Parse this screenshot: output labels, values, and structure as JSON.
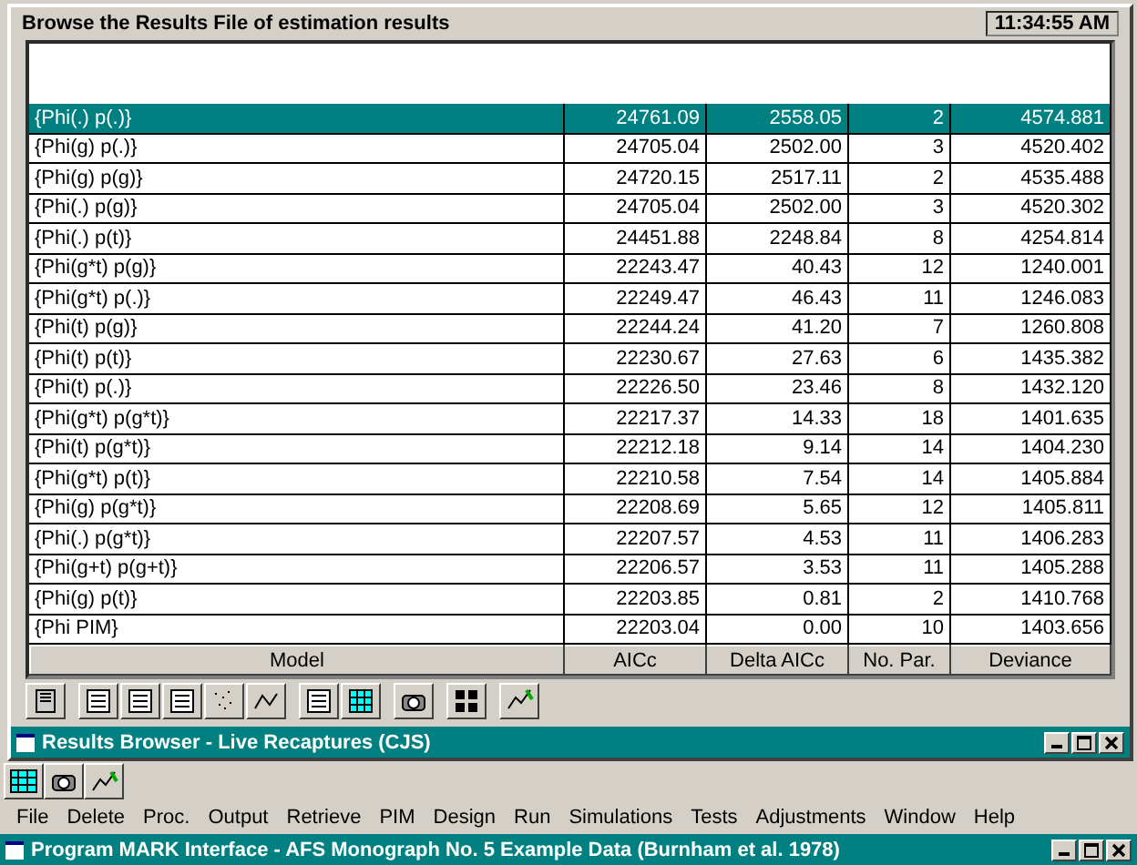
{
  "window": {
    "title": "Program MARK Interface - AFS Monograph No. 5 Example Data (Burnham et al. 1978)"
  },
  "menu": [
    "File",
    "Delete",
    "Proc.",
    "Output",
    "Retrieve",
    "PIM",
    "Design",
    "Run",
    "Simulations",
    "Tests",
    "Adjustments",
    "Window",
    "Help"
  ],
  "browser": {
    "title": "Results Browser - Live Recaptures (CJS)",
    "rows": [
      {
        "selected": true,
        "cells": [
          "{Phi(.) p(.)}",
          "24761.09",
          "2558.05",
          "2",
          "4574.881"
        ]
      },
      {
        "selected": false,
        "cells": [
          "{Phi(g) p(.)}",
          "24705.04",
          "2502.00",
          "3",
          "4520.402"
        ]
      },
      {
        "selected": false,
        "cells": [
          "{Phi(g) p(g)}",
          "24720.15",
          "2517.11",
          "2",
          "4535.488"
        ]
      },
      {
        "selected": false,
        "cells": [
          "{Phi(.) p(g)}",
          "24705.04",
          "2502.00",
          "3",
          "4520.302"
        ]
      },
      {
        "selected": false,
        "cells": [
          "{Phi(.) p(t)}",
          "24451.88",
          "2248.84",
          "8",
          "4254.814"
        ]
      },
      {
        "selected": false,
        "cells": [
          "{Phi(g*t) p(g)}",
          "22243.47",
          "40.43",
          "12",
          "1240.001"
        ]
      },
      {
        "selected": false,
        "cells": [
          "{Phi(g*t) p(.)}",
          "22249.47",
          "46.43",
          "11",
          "1246.083"
        ]
      },
      {
        "selected": false,
        "cells": [
          "{Phi(t) p(g)}",
          "22244.24",
          "41.20",
          "7",
          "1260.808"
        ]
      },
      {
        "selected": false,
        "cells": [
          "{Phi(t) p(t)}",
          "22230.67",
          "27.63",
          "6",
          "1435.382"
        ]
      },
      {
        "selected": false,
        "cells": [
          "{Phi(t) p(.)}",
          "22226.50",
          "23.46",
          "8",
          "1432.120"
        ]
      },
      {
        "selected": false,
        "cells": [
          "{Phi(g*t) p(g*t)}",
          "22217.37",
          "14.33",
          "18",
          "1401.635"
        ]
      },
      {
        "selected": false,
        "cells": [
          "{Phi(t) p(g*t)}",
          "22212.18",
          "9.14",
          "14",
          "1404.230"
        ]
      },
      {
        "selected": false,
        "cells": [
          "{Phi(g*t) p(t)}",
          "22210.58",
          "7.54",
          "14",
          "1405.884"
        ]
      },
      {
        "selected": false,
        "cells": [
          "{Phi(g) p(g*t)}",
          "22208.69",
          "5.65",
          "12",
          "1405.811"
        ]
      },
      {
        "selected": false,
        "cells": [
          "{Phi(.) p(g*t)}",
          "22207.57",
          "4.53",
          "11",
          "1406.283"
        ]
      },
      {
        "selected": false,
        "cells": [
          "{Phi(g+t) p(g+t)}",
          "22206.57",
          "3.53",
          "11",
          "1405.288"
        ]
      },
      {
        "selected": false,
        "cells": [
          "{Phi(g) p(t)}",
          "22203.85",
          "0.81",
          "2",
          "1410.768"
        ]
      },
      {
        "selected": false,
        "cells": [
          "{Phi PIM}",
          "22203.04",
          "0.00",
          "10",
          "1403.656"
        ]
      }
    ],
    "column_headers_below": [
      "Model",
      "AICc",
      "Delta AICc",
      "No. Par.",
      "Deviance"
    ]
  },
  "status_bar": {
    "message": "Browse the Results File of estimation results",
    "time": "11:34:55 AM"
  }
}
